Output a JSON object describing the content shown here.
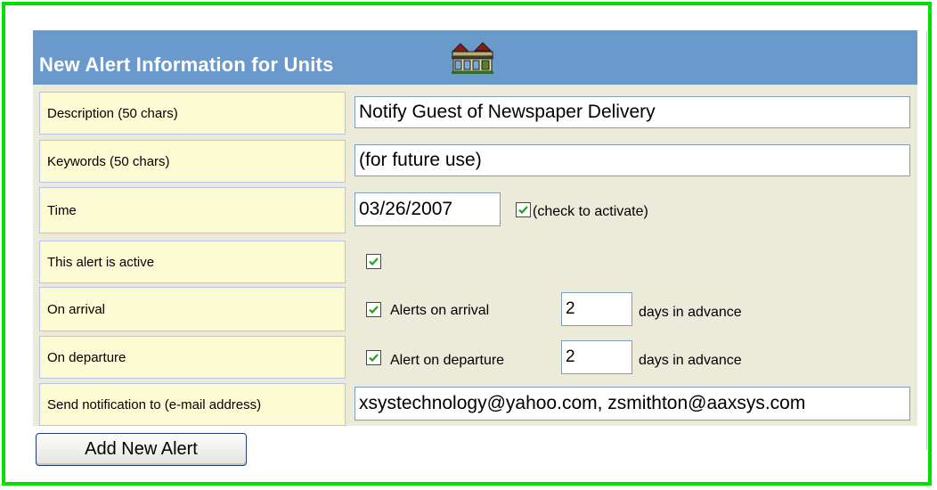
{
  "header": {
    "title": "New Alert Information for Units",
    "icon": "building-icon"
  },
  "form": {
    "description": {
      "label": "Description (50 chars)",
      "value": "Notify Guest of Newspaper Delivery"
    },
    "keywords": {
      "label": "Keywords (50 chars)",
      "value": "(for future use)"
    },
    "time": {
      "label": "Time",
      "value": "03/26/2007",
      "activate_checked": true,
      "activate_label": "(check to activate)"
    },
    "active": {
      "label": "This alert is active",
      "checked": true
    },
    "arrival": {
      "label": "On arrival",
      "checked": true,
      "checkbox_label": "Alerts on arrival",
      "days": "2",
      "suffix": "days in advance"
    },
    "departure": {
      "label": "On departure",
      "checked": true,
      "checkbox_label": "Alert on departure",
      "days": "2",
      "suffix": "days in advance"
    },
    "notify": {
      "label": "Send notification to (e-mail address)",
      "value": "xsystechnology@yahoo.com, zsmithton@aaxsys.com"
    }
  },
  "buttons": {
    "add_label": "Add New Alert"
  },
  "colors": {
    "frame": "#00e000",
    "header": "#6a9acb",
    "panel": "#ecead9",
    "label_bg": "#fcfbd3",
    "check": "#21a121"
  }
}
